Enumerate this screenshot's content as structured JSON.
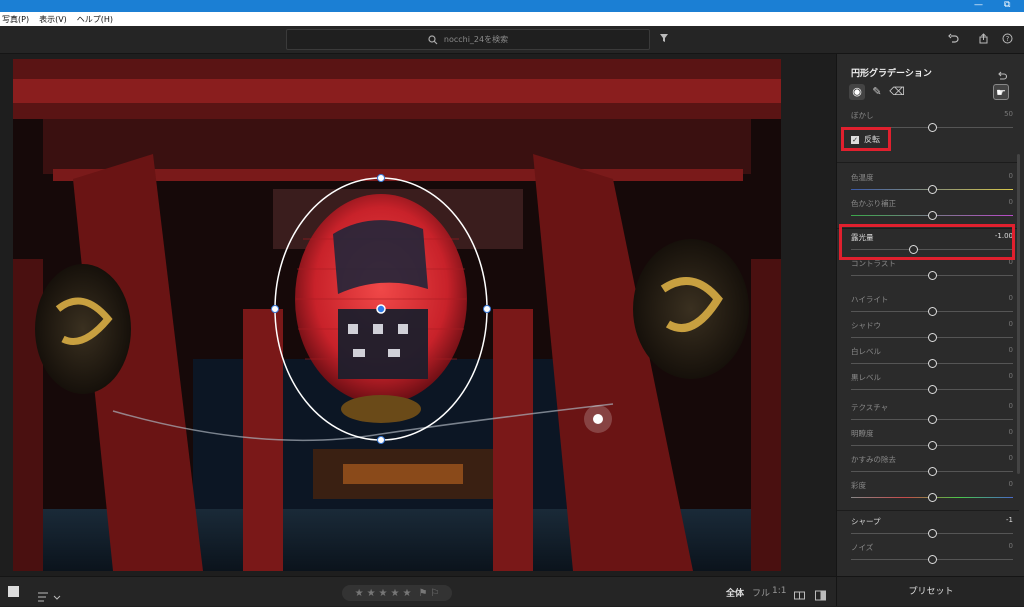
{
  "menu": [
    "写真(P)",
    "表示(V)",
    "ヘルプ(H)"
  ],
  "window_controls": [
    "—",
    "⧉"
  ],
  "search": {
    "placeholder": "nocchi_24を検索"
  },
  "panel": {
    "title": "円形グラデーション",
    "checkbox_label": "反転",
    "feather": {
      "label": "ぼかし",
      "value": "50",
      "position": 0.5
    },
    "sliders": [
      {
        "name": "color-temp",
        "label": "色温度",
        "value": "0",
        "position": 0.5,
        "bright": false
      },
      {
        "name": "tint",
        "label": "色かぶり補正",
        "value": "0",
        "position": 0.5,
        "bright": false
      },
      {
        "name": "exposure",
        "label": "露光量",
        "value": "-1.00",
        "position": 0.38,
        "bright": true
      },
      {
        "name": "contrast",
        "label": "コントラスト",
        "value": "0",
        "position": 0.5,
        "bright": false
      },
      {
        "name": "highlights",
        "label": "ハイライト",
        "value": "0",
        "position": 0.5,
        "bright": false
      },
      {
        "name": "shadows",
        "label": "シャドウ",
        "value": "0",
        "position": 0.5,
        "bright": false
      },
      {
        "name": "whites",
        "label": "白レベル",
        "value": "0",
        "position": 0.5,
        "bright": false
      },
      {
        "name": "blacks",
        "label": "黒レベル",
        "value": "0",
        "position": 0.5,
        "bright": false
      },
      {
        "name": "texture",
        "label": "テクスチャ",
        "value": "0",
        "position": 0.5,
        "bright": false
      },
      {
        "name": "clarity",
        "label": "明瞭度",
        "value": "0",
        "position": 0.5,
        "bright": false
      },
      {
        "name": "dehaze",
        "label": "かすみの除去",
        "value": "0",
        "position": 0.5,
        "bright": false
      },
      {
        "name": "saturation",
        "label": "彩度",
        "value": "0",
        "position": 0.5,
        "bright": false
      },
      {
        "name": "sharpness",
        "label": "シャープ",
        "value": "-1",
        "position": 0.5,
        "bright": true
      },
      {
        "name": "noise",
        "label": "ノイズ",
        "value": "0",
        "position": 0.5,
        "bright": false
      }
    ],
    "preset_label": "プリセット"
  },
  "bottom": {
    "view_all": "全体",
    "view_full": "フル",
    "view_1to1": "1:1"
  },
  "colors": {
    "highlight": "#e0202e",
    "os_bar": "#1b7fd4"
  }
}
